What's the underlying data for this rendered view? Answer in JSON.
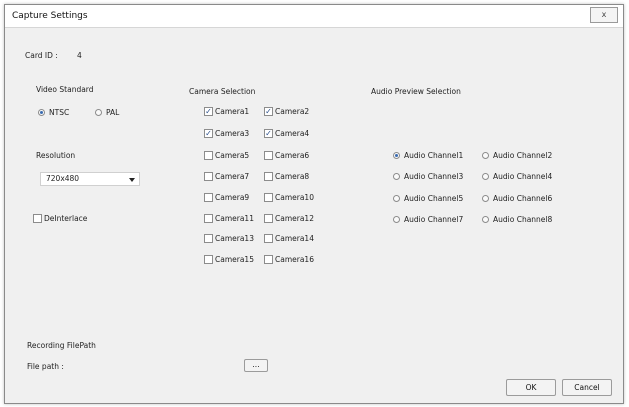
{
  "window": {
    "title": "Capture Settings",
    "close_label": "x"
  },
  "card": {
    "label": "Card ID :",
    "value": "4"
  },
  "video_standard": {
    "label": "Video Standard",
    "options": [
      {
        "label": "NTSC",
        "selected": true
      },
      {
        "label": "PAL",
        "selected": false
      }
    ]
  },
  "resolution": {
    "label": "Resolution",
    "value": "720x480"
  },
  "deinterlace": {
    "label": "DeInterlace",
    "checked": false
  },
  "camera_selection": {
    "label": "Camera Selection",
    "cameras": [
      {
        "label": "Camera1",
        "checked": true
      },
      {
        "label": "Camera2",
        "checked": true
      },
      {
        "label": "Camera3",
        "checked": true
      },
      {
        "label": "Camera4",
        "checked": true
      },
      {
        "label": "Camera5",
        "checked": false
      },
      {
        "label": "Camera6",
        "checked": false
      },
      {
        "label": "Camera7",
        "checked": false
      },
      {
        "label": "Camera8",
        "checked": false
      },
      {
        "label": "Camera9",
        "checked": false
      },
      {
        "label": "Camera10",
        "checked": false
      },
      {
        "label": "Camera11",
        "checked": false
      },
      {
        "label": "Camera12",
        "checked": false
      },
      {
        "label": "Camera13",
        "checked": false
      },
      {
        "label": "Camera14",
        "checked": false
      },
      {
        "label": "Camera15",
        "checked": false
      },
      {
        "label": "Camera16",
        "checked": false
      }
    ]
  },
  "audio_preview": {
    "label": "Audio Preview Selection",
    "channels": [
      {
        "label": "Audio Channel1",
        "selected": true
      },
      {
        "label": "Audio Channel2",
        "selected": false
      },
      {
        "label": "Audio Channel3",
        "selected": false
      },
      {
        "label": "Audio Channel4",
        "selected": false
      },
      {
        "label": "Audio Channel5",
        "selected": false
      },
      {
        "label": "Audio Channel6",
        "selected": false
      },
      {
        "label": "Audio Channel7",
        "selected": false
      },
      {
        "label": "Audio Channel8",
        "selected": false
      }
    ]
  },
  "recording": {
    "section_label": "Recording FilePath",
    "path_label": "File path :",
    "path_value": "",
    "browse_label": "..."
  },
  "buttons": {
    "ok_label": "OK",
    "cancel_label": "Cancel"
  }
}
